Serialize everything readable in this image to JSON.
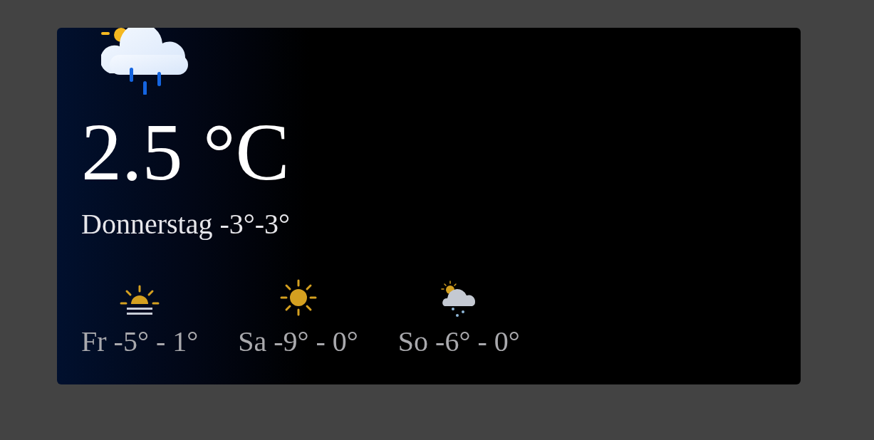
{
  "current": {
    "kind": "rain-sun",
    "temperature": "2.5 °C",
    "day": "Donnerstag",
    "range": "-3°-3°"
  },
  "forecast": [
    {
      "kind": "fog-sun",
      "day": "Fr",
      "range": "-5° - 1°"
    },
    {
      "kind": "sun",
      "day": "Sa",
      "range": "-9° - 0°"
    },
    {
      "kind": "snow-sun",
      "day": "So",
      "range": "-6° - 0°"
    }
  ]
}
